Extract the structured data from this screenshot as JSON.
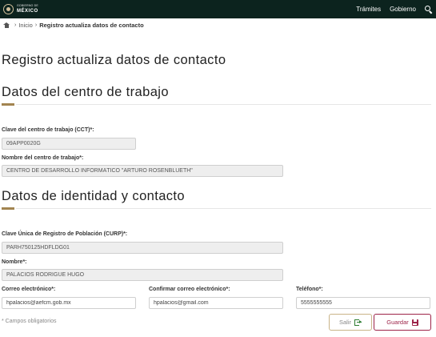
{
  "header": {
    "logo_small": "GOBIERNO DE",
    "logo_big": "MÉXICO",
    "nav": [
      {
        "label": "Trámites"
      },
      {
        "label": "Gobierno"
      }
    ],
    "bg_color": "#0c231e"
  },
  "breadcrumb": {
    "home": "Inicio",
    "current": "Registro actualiza datos de contacto"
  },
  "page": {
    "title": "Registro actualiza datos de contacto"
  },
  "sections": {
    "workplace": {
      "title": "Datos del centro de trabajo",
      "cct_label": "Clave del centro de trabajo (CCT)*:",
      "cct_value": "09APP0020G",
      "name_label": "Nombre del centro de trabajo*:",
      "name_value": "CENTRO DE DESARROLLO INFORMÁTICO \"ARTURO ROSENBLUETH\""
    },
    "identity": {
      "title": "Datos de identidad y contacto",
      "curp_label": "Clave Única de Registro de Población (CURP)*:",
      "curp_value": "PARH750125HDFLDG01",
      "nombre_label": "Nombre*:",
      "nombre_value": "PALACIOS RODRIGUE HUGO",
      "email_label": "Correo electrónico*:",
      "email_value": "hpalacios@aefcm.gob.mx",
      "email_confirm_label": "Confirmar correo electrónico*:",
      "email_confirm_value": "hpalacios@gmail.com",
      "phone_label": "Teléfono*:",
      "phone_value": "5555555555"
    }
  },
  "footer": {
    "required_note": "* Campos obligatorios",
    "exit_label": "Salir",
    "save_label": "Guardar"
  },
  "colors": {
    "accent_gold": "#a28450",
    "save_red": "#9d2449",
    "exit_green": "#2e7d32"
  }
}
